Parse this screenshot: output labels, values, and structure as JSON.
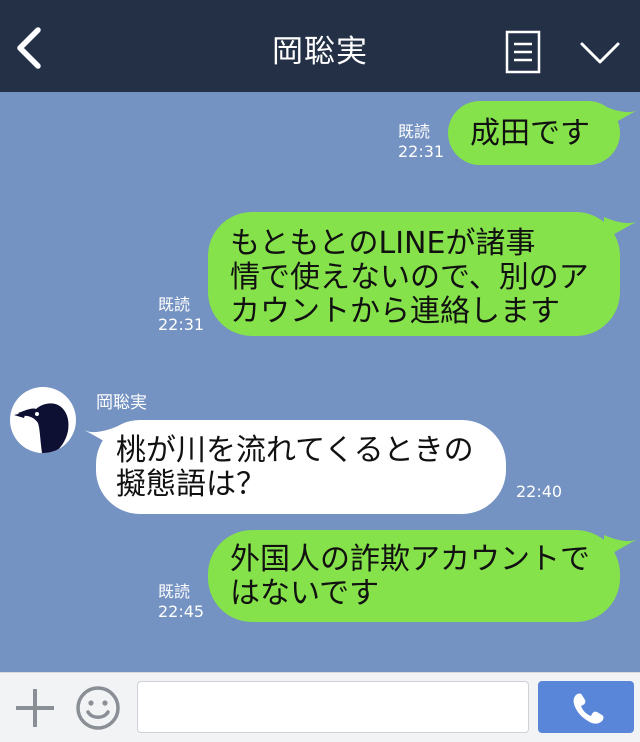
{
  "header": {
    "title": "岡聡実",
    "back_icon": "chevron-left-icon",
    "notes_icon": "notes-icon",
    "menu_icon": "chevron-down-icon"
  },
  "colors": {
    "header_bg": "#233046",
    "chat_bg": "#7492c2",
    "sent_bubble": "#86e24a",
    "received_bubble": "#ffffff",
    "call_button": "#5a86d9"
  },
  "messages": [
    {
      "direction": "sent",
      "lines": [
        "成田です"
      ],
      "read_label": "既読",
      "time": "22:31"
    },
    {
      "direction": "sent",
      "lines": [
        "もともとのLINEが諸事",
        "情で使えないので、別のア",
        "カウントから連絡します"
      ],
      "read_label": "既読",
      "time": "22:31"
    },
    {
      "direction": "received",
      "sender": "岡聡実",
      "lines": [
        "桃が川を流れてくるときの",
        "擬態語は？"
      ],
      "time": "22:40"
    },
    {
      "direction": "sent",
      "lines": [
        "外国人の詐欺アカウントで",
        "はないです"
      ],
      "read_label": "既読",
      "time": "22:45"
    }
  ],
  "input_bar": {
    "plus_icon": "plus-icon",
    "emoji_icon": "smiley-icon",
    "message_value": "",
    "call_icon": "phone-icon"
  }
}
